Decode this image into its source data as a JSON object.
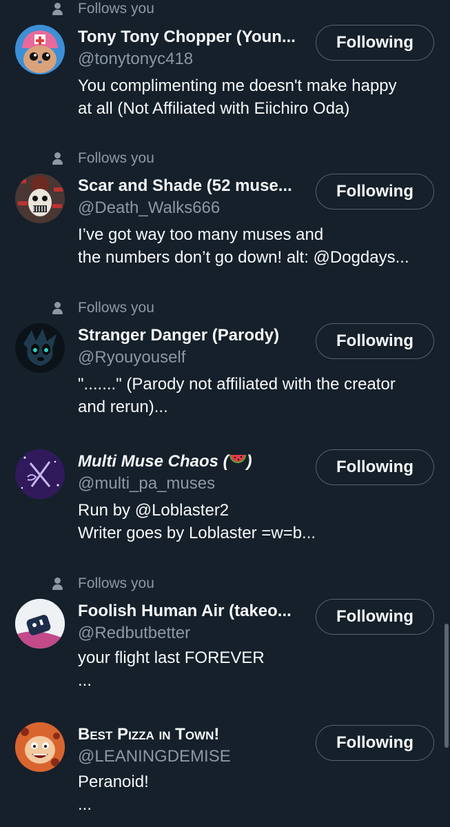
{
  "follows_label": "Follows you",
  "button_label": "Following",
  "accounts": [
    {
      "name": "Tony Tony Chopper (Youn...",
      "handle": "@tonytonyc418",
      "bio": [
        "You complimenting me doesn't make happy",
        "at all (Not Affiliated with Eiichiro Oda)"
      ],
      "follows_you": true
    },
    {
      "name": "Scar and Shade (52 muse...",
      "handle": "@Death_Walks666",
      "bio": [
        "I’ve got way too many muses and",
        "the numbers don’t go down! alt: @Dogdays..."
      ],
      "follows_you": true
    },
    {
      "name": "Stranger Danger (Parody)",
      "handle": "@Ryouyouself",
      "bio": [
        "\".......\" (Parody not affiliated with the creator",
        "and rerun)..."
      ],
      "follows_you": true
    },
    {
      "name": "Multi Muse Chaos (",
      "name_suffix": ")",
      "name_emoji": "watermelon-icon",
      "handle": "@multi_pa_muses",
      "bio": [
        "Run by @Loblaster2",
        "Writer goes by Loblaster =w=b..."
      ],
      "follows_you": false
    },
    {
      "name": "Foolish Human Air (takeo...",
      "handle": "@Redbutbetter",
      "bio": [
        "your flight last FOREVER",
        "..."
      ],
      "follows_you": true
    },
    {
      "name": "Best Pizza in Town!",
      "handle": "@LEANINGDEMISE",
      "bio": [
        "Peranoid!",
        "..."
      ],
      "follows_you": false
    }
  ],
  "colors": {
    "background": "#15202b",
    "secondary_text": "#8b98a5",
    "button_border": "#536471"
  }
}
